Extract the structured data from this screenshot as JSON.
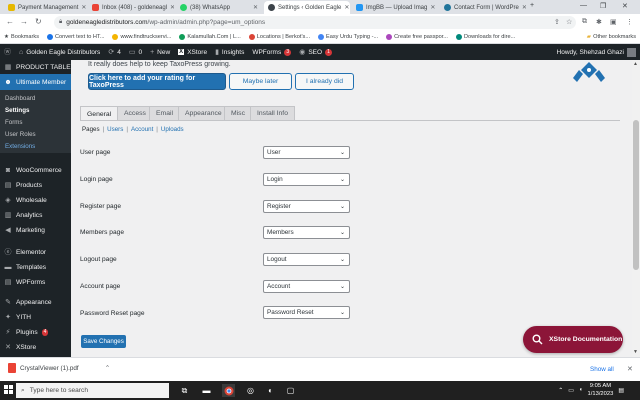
{
  "browser": {
    "tabs": [
      {
        "title": "Payment Management",
        "color": "#e6b800"
      },
      {
        "title": "Inbox (408) - goldeneagl",
        "color": "#ea4335"
      },
      {
        "title": "(38) WhatsApp",
        "color": "#25d366"
      },
      {
        "title": "Settings ‹ Golden Eagle",
        "color": "#3c434a"
      },
      {
        "title": "ImgBB — Upload Imag",
        "color": "#2196f3"
      },
      {
        "title": "Contact Form | WordPre",
        "color": "#21759b"
      }
    ],
    "url_domain": "goldeneagledistributors.com",
    "url_path": "/wp-admin/admin.php?page=um_options",
    "bookmarks": [
      {
        "label": "Bookmarks",
        "color": "#5f6368"
      },
      {
        "label": "Convert text to HT...",
        "color": "#1a73e8"
      },
      {
        "label": "www.findtruckservi...",
        "color": "#f4b400"
      },
      {
        "label": "Kalamullah.Com | L...",
        "color": "#0f9d58"
      },
      {
        "label": "Locations | Berkot's...",
        "color": "#db4437"
      },
      {
        "label": "Easy Urdu Typing -...",
        "color": "#4285f4"
      },
      {
        "label": "Create free passpor...",
        "color": "#ab47bc"
      },
      {
        "label": "Downloads for dire...",
        "color": "#00897b"
      }
    ],
    "other_bookmarks": "Other bookmarks"
  },
  "adminbar": {
    "site_name": "Golden Eagle Distributors",
    "updates_count": "4",
    "comments_count": "0",
    "new_label": "New",
    "xstore_label": "XStore",
    "insights_label": "Insights",
    "wpforms_label": "WPForms",
    "wpforms_count": "3",
    "seo_label": "SEO",
    "seo_count": "1",
    "howdy": "Howdy, Shehzad Ghazi"
  },
  "sidebar": {
    "top_items": [
      {
        "label": "PRODUCT TABLE",
        "icon": "table-icon"
      },
      {
        "label": "Ultimate Member",
        "icon": "user-icon"
      }
    ],
    "submenu": [
      "Dashboard",
      "Settings",
      "Forms",
      "User Roles",
      "Extensions"
    ],
    "items": [
      {
        "label": "WooCommerce",
        "icon": "woo-icon"
      },
      {
        "label": "Products",
        "icon": "box-icon"
      },
      {
        "label": "Wholesale",
        "icon": "tag-icon"
      },
      {
        "label": "Analytics",
        "icon": "chart-icon"
      },
      {
        "label": "Marketing",
        "icon": "megaphone-icon"
      },
      {
        "label": "Elementor",
        "icon": "elementor-icon"
      },
      {
        "label": "Templates",
        "icon": "folder-icon"
      },
      {
        "label": "WPForms",
        "icon": "form-icon"
      },
      {
        "label": "Appearance",
        "icon": "brush-icon"
      },
      {
        "label": "YITH",
        "icon": "yith-icon"
      },
      {
        "label": "Plugins",
        "icon": "plug-icon",
        "badge": "4"
      },
      {
        "label": "XStore",
        "icon": "x-icon"
      }
    ]
  },
  "notice": {
    "text": "It really does help to keep TaxoPress growing.",
    "rate_button": "Click here to add your rating for TaxoPress",
    "later_button": "Maybe later",
    "did_button": "I already did"
  },
  "settings": {
    "tabs": [
      "General",
      "Access",
      "Email",
      "Appearance",
      "Misc",
      "Install Info"
    ],
    "subsections": [
      "Pages",
      "Users",
      "Account",
      "Uploads"
    ],
    "fields": [
      {
        "label": "User page",
        "value": "User"
      },
      {
        "label": "Login page",
        "value": "Login"
      },
      {
        "label": "Register page",
        "value": "Register"
      },
      {
        "label": "Members page",
        "value": "Members"
      },
      {
        "label": "Logout page",
        "value": "Logout"
      },
      {
        "label": "Account page",
        "value": "Account"
      },
      {
        "label": "Password Reset page",
        "value": "Password Reset"
      }
    ],
    "save_label": "Save Changes"
  },
  "xstore_doc": "XStore Documentation",
  "downloads": {
    "file": "CrystalViewer (1).pdf",
    "show_all": "Show all"
  },
  "taskbar": {
    "search_placeholder": "Type here to search",
    "time": "9:05 AM",
    "date": "1/13/2023"
  },
  "colors": {
    "wp_dark": "#1d2327",
    "wp_blue": "#2271b1",
    "xstore_red": "#8c1538"
  }
}
